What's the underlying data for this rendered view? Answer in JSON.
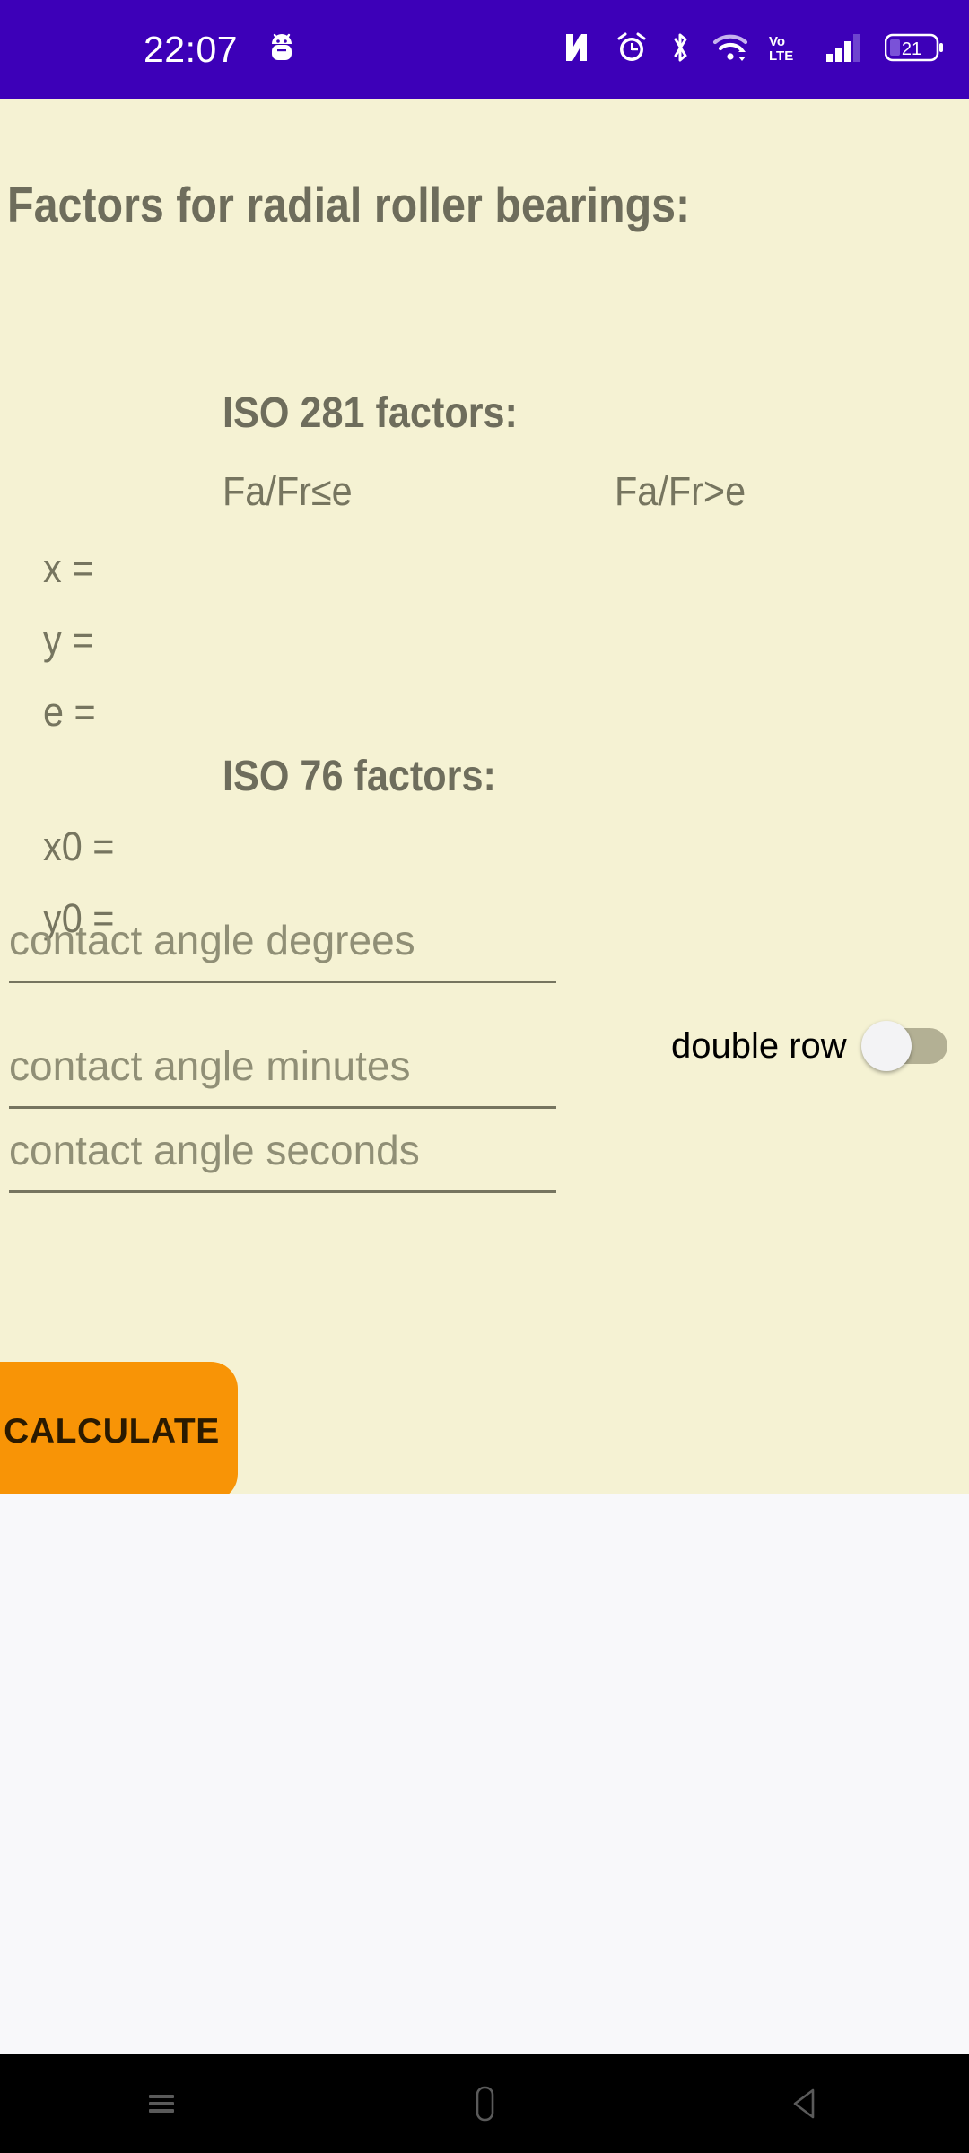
{
  "status_bar": {
    "time": "22:07",
    "background_color": "#3d00b8",
    "left_icons": [
      {
        "name": "android-robot-icon"
      }
    ],
    "right_icons": [
      {
        "name": "nfc-icon"
      },
      {
        "name": "alarm-clock-icon"
      },
      {
        "name": "bluetooth-icon"
      },
      {
        "name": "wifi-icon"
      },
      {
        "name": "volte-icon",
        "label": "VoLTE"
      },
      {
        "name": "cellular-signal-icon"
      }
    ],
    "battery": {
      "name": "battery-icon",
      "level": "21"
    }
  },
  "content": {
    "background_color": "#f5f2d3",
    "title": "Factors for radial roller bearings:",
    "iso281": {
      "heading": "ISO 281 factors:",
      "column_headers": [
        "Fa/Fr≤e",
        "Fa/Fr>e"
      ],
      "rows": [
        {
          "label": "x =",
          "value_le": "",
          "value_gt": ""
        },
        {
          "label": "y =",
          "value_le": "",
          "value_gt": ""
        },
        {
          "label": "e =",
          "value_le": "",
          "value_gt": ""
        }
      ]
    },
    "iso76": {
      "heading": "ISO 76 factors:",
      "rows": [
        {
          "label": "x0 =",
          "value": ""
        },
        {
          "label": "y0 =",
          "value": ""
        }
      ]
    },
    "inputs": [
      {
        "name": "contact-angle-degrees",
        "placeholder": "contact angle degrees",
        "value": ""
      },
      {
        "name": "contact-angle-minutes",
        "placeholder": "contact angle minutes",
        "value": ""
      },
      {
        "name": "contact-angle-seconds",
        "placeholder": "contact angle seconds",
        "value": ""
      }
    ],
    "toggle": {
      "label": "double row",
      "state": "off"
    },
    "calculate_button": {
      "label": "CALCULATE",
      "color": "#f89406"
    }
  },
  "nav_bar": {
    "background_color": "#000000",
    "buttons": [
      {
        "name": "recents-button"
      },
      {
        "name": "home-button"
      },
      {
        "name": "back-button"
      }
    ]
  }
}
